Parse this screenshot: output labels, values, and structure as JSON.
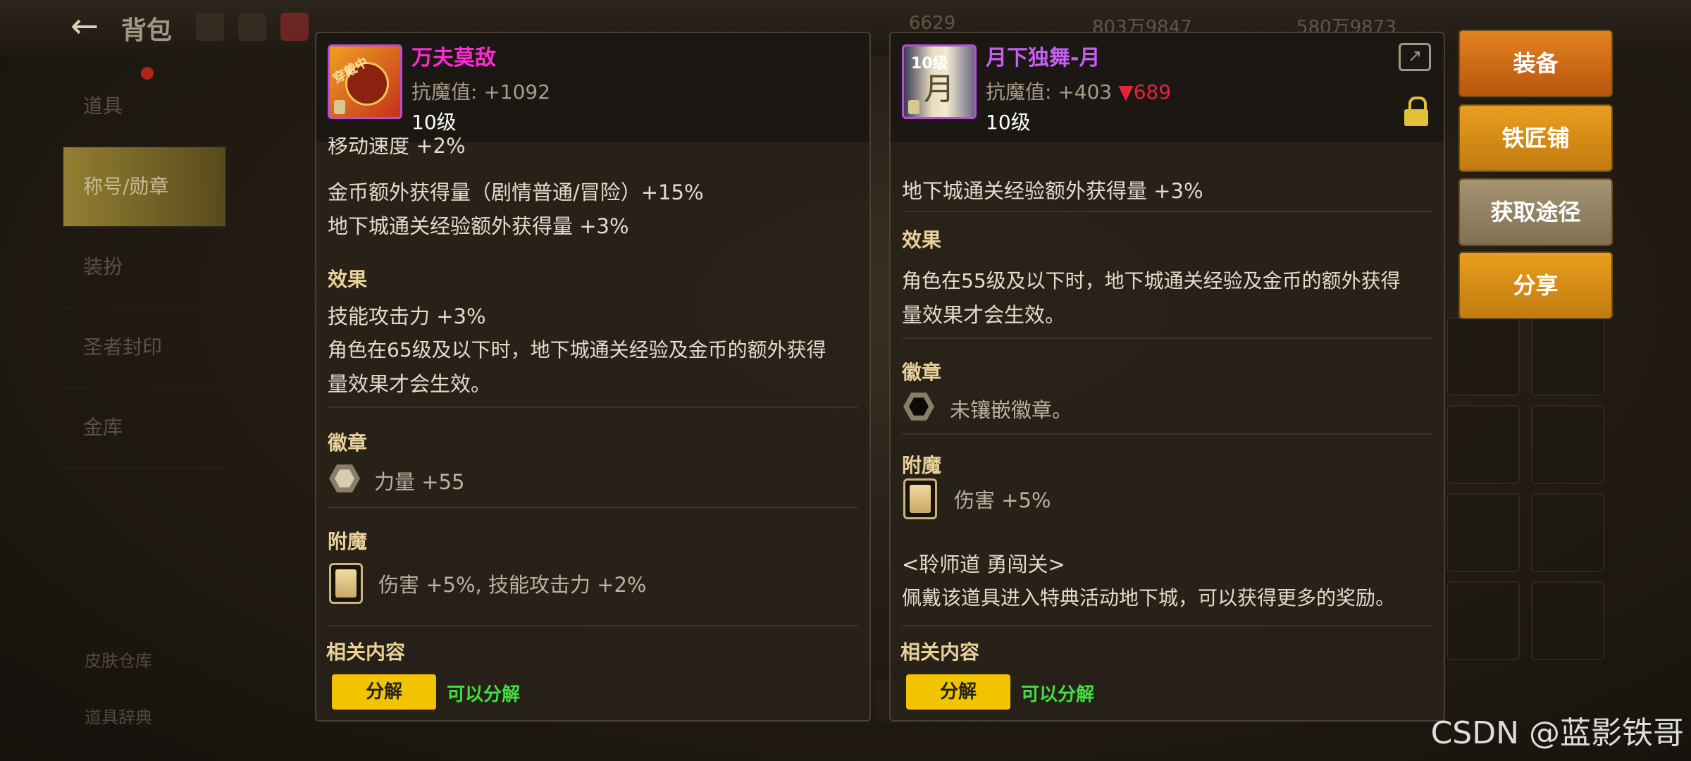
{
  "topbar": {
    "back_icon": "arrow-left-icon",
    "title": "背包",
    "currencies": [
      "6629",
      "803万9847",
      "580万9873"
    ]
  },
  "sidebar": {
    "items": [
      {
        "label": "道具"
      },
      {
        "label": "称号/勋章"
      },
      {
        "label": "装扮"
      },
      {
        "label": "圣者封印"
      },
      {
        "label": "金库"
      }
    ],
    "bottom": [
      "皮肤仓库",
      "道具辞典"
    ]
  },
  "item_left": {
    "thumb_tag": "穿戴中",
    "name": "万夫莫敌",
    "stat_label": "抗魔值:",
    "stat_value": "+1092",
    "level": "10级",
    "lines_top": [
      "移动速度 +2%",
      "金币额外获得量（剧情普通/冒险）+15%",
      "地下城通关经验额外获得量 +3%"
    ],
    "effect_title": "效果",
    "effect_lines": [
      "技能攻击力 +3%",
      "角色在65级及以下时，地下城通关经验及金币的额外获得",
      "量效果才会生效。"
    ],
    "badge_title": "徽章",
    "badge_text": "力量 +55",
    "enchant_title": "附魔",
    "enchant_text": "伤害 +5%, 技能攻击力 +2%",
    "related_title": "相关内容",
    "disassemble_btn": "分解",
    "disassemble_status": "可以分解"
  },
  "item_right": {
    "thumb_tag": "10级",
    "thumb_char": "月",
    "name": "月下独舞-月",
    "stat_label": "抗魔值:",
    "stat_value": "+403",
    "stat_diff": "▼689",
    "level": "10级",
    "lines_top": [
      "地下城通关经验额外获得量 +3%"
    ],
    "effect_title": "效果",
    "effect_lines": [
      "角色在55级及以下时，地下城通关经验及金币的额外获得",
      "量效果才会生效。"
    ],
    "badge_title": "徽章",
    "badge_text": "未镶嵌徽章。",
    "enchant_title": "附魔",
    "enchant_text": "伤害 +5%",
    "event_title": "<聆师道 勇闯关>",
    "event_desc": "佩戴该道具进入特典活动地下城，可以获得更多的奖励。",
    "related_title": "相关内容",
    "disassemble_btn": "分解",
    "disassemble_status": "可以分解"
  },
  "actions": {
    "equip": "装备",
    "smith": "铁匠铺",
    "obtain": "获取途径",
    "share": "分享"
  },
  "watermark": "CSDN @蓝影铁哥",
  "colors": {
    "name_left": "#ff2ad4",
    "name_right": "#c55ef5",
    "down": "#e5233a",
    "section": "#ead19a",
    "can": "#40e040",
    "btn": "#f2c400"
  }
}
